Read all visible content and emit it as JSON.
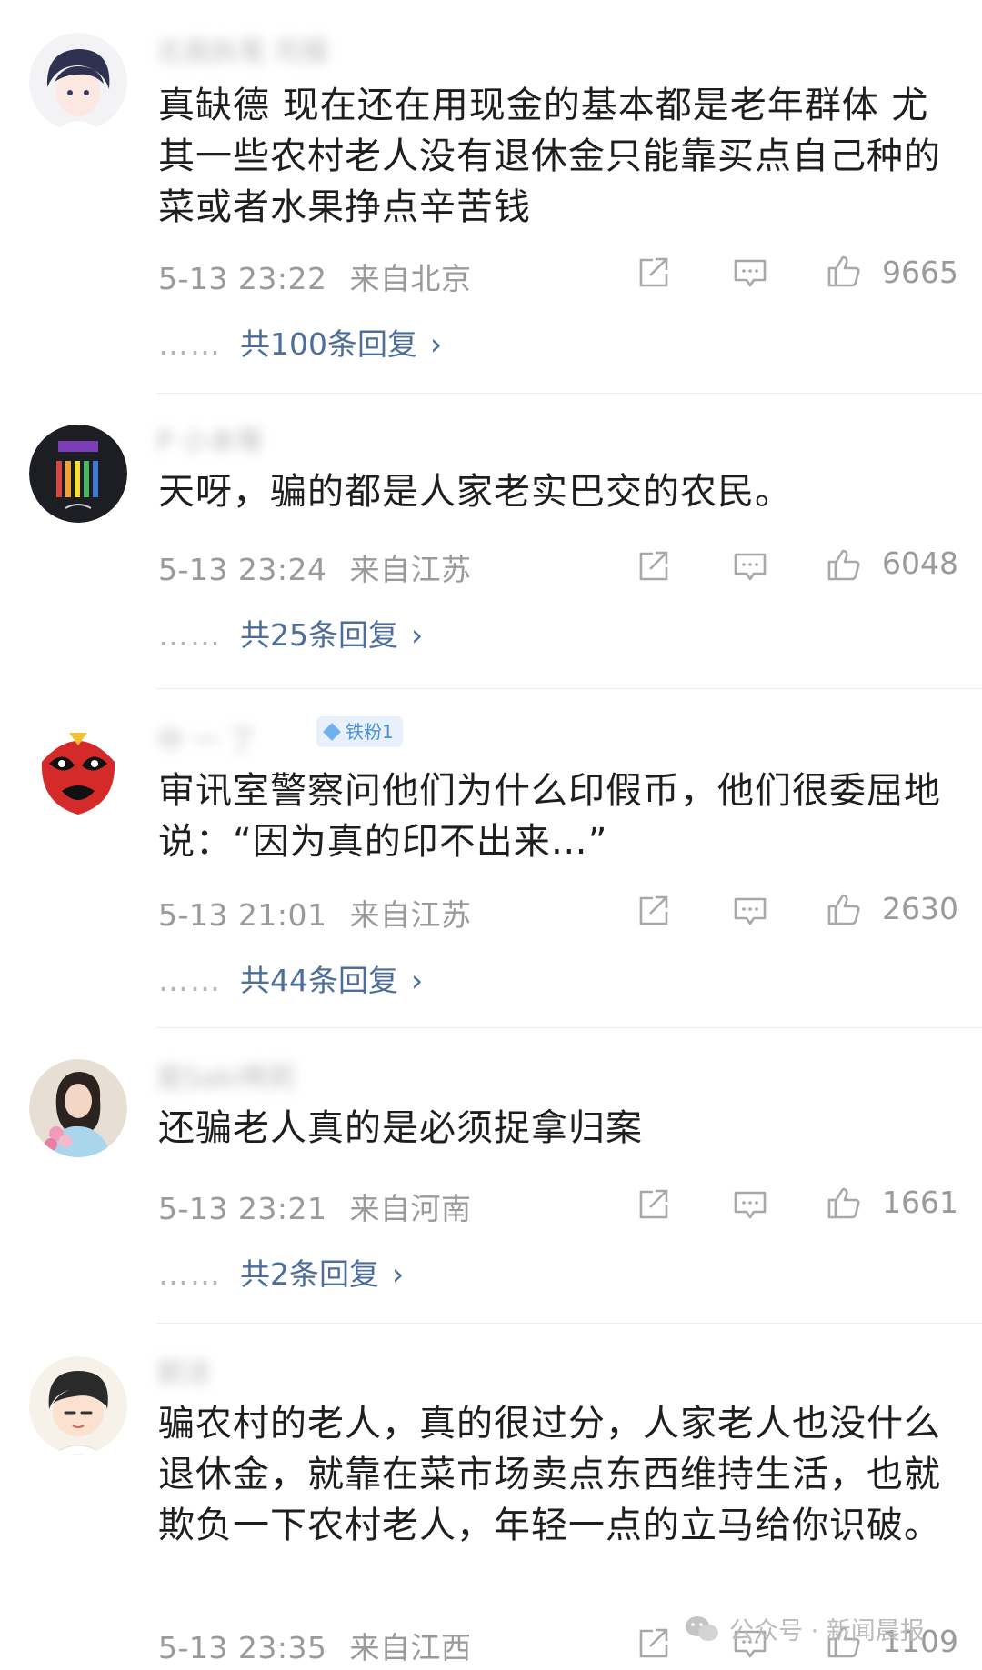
{
  "comments": [
    {
      "username": "北我执笔 司报",
      "text": "真缺德 现在还在用现金的基本都是老年群体 尤其一些农村老人没有退休金只能靠买点自己种的菜或者水果挣点辛苦钱",
      "time": "5-13 23:22",
      "location": "来自北京",
      "likes": "9665",
      "replies": "共100条回复"
    },
    {
      "username": "P 小本等",
      "text": "天呀，骗的都是人家老实巴交的农民。",
      "time": "5-13 23:24",
      "location": "来自江苏",
      "likes": "6048",
      "replies": "共25条回复"
    },
    {
      "username": "中 一 了",
      "badge": "铁粉1",
      "text": "审讯室警察问他们为什么印假币，他们很委屈地说：“因为真的印不出来…”",
      "time": "5-13 21:01",
      "location": "来自江苏",
      "likes": "2630",
      "replies": "共44条回复"
    },
    {
      "username": "是Saki啊莉",
      "text": "还骗老人真的是必须捉拿归案",
      "time": "5-13 23:21",
      "location": "来自河南",
      "likes": "1661",
      "replies": "共2条回复"
    },
    {
      "username": "郭凉",
      "text": "骗农村的老人，真的很过分，人家老人也没什么退休金，就靠在菜市场卖点东西维持生活，也就欺负一下农村老人，年轻一点的立马给你识破。",
      "time": "5-13 23:35",
      "location": "来自江西",
      "likes": "1109"
    }
  ],
  "ui": {
    "reply_dots": "……",
    "reply_chevron": "›"
  },
  "watermark": "公众号 · 新闻晨报",
  "icons": [
    "share-icon",
    "comment-icon",
    "like-icon",
    "wechat-icon"
  ]
}
